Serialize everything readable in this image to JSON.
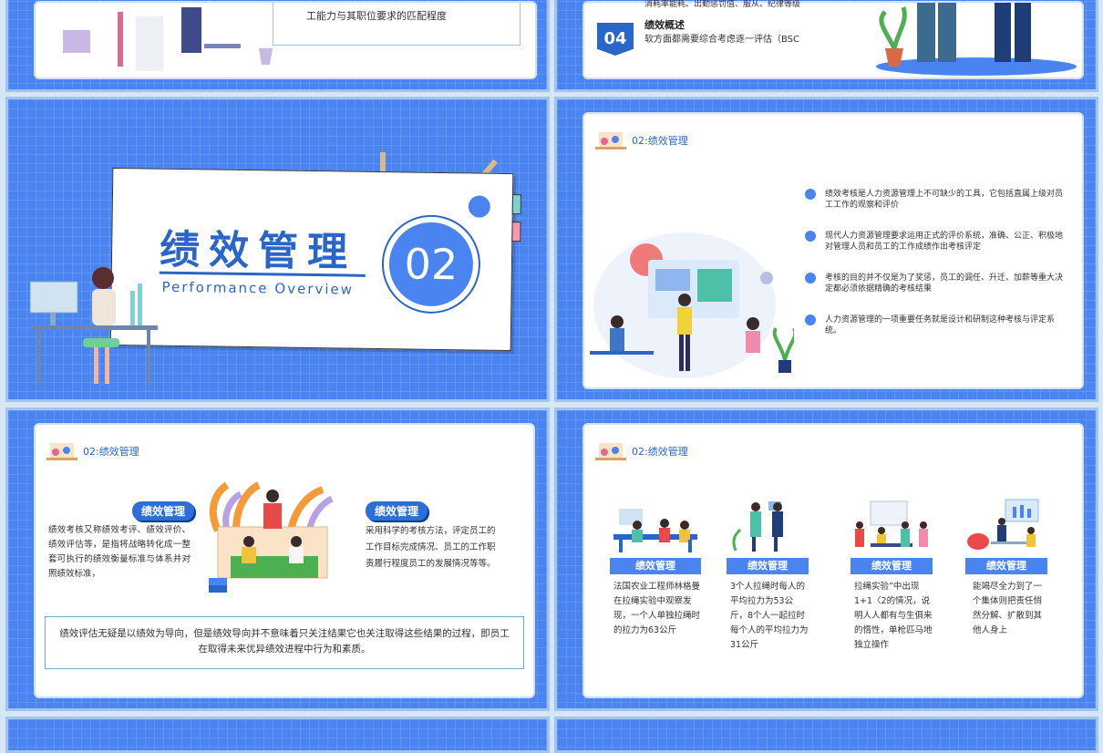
{
  "slide_top_left": {
    "caption": "工能力与其职位要求的匹配程度"
  },
  "slide_top_right": {
    "prev_text": "消耗率能耗、出勤惩罚值、服从、纪律等级",
    "item_number": "04",
    "item_title": "绩效概述",
    "item_text": "软方面都需要综合考虑逐一评估（BSC"
  },
  "title_slide": {
    "title": "绩效管理",
    "subtitle": "Performance Overview",
    "number": "02"
  },
  "list_slide": {
    "header": "02:绩效管理",
    "items": [
      "绩效考核是人力资源管理上不可缺少的工具，它包括直属上级对员工工作的观察和评价",
      "现代人力资源管理要求运用正式的评价系统，准确、公正、积极地对管理人员和员工的工作成绩作出考核评定",
      "考核的目的并不仅是为了奖惩，员工的调任、升迁、加薪等重大决定都必须依据精确的考核结果",
      "人力资源管理的一项重要任务就是设计和研制这种考核与评定系统。"
    ]
  },
  "two_col_slide": {
    "header": "02:绩效管理",
    "left_label": "绩效管理",
    "left_text": "绩效考核又称绩效考评、绩效评价、绩效评估等，是指将战略转化成一整套可执行的绩效衡量标准与体系并对照绩效标准，",
    "right_label": "绩效管理",
    "right_text": "采用科学的考核方法，评定员工的工作目标完成情况、员工的工作职责履行程度员工的发展情况等等。",
    "bottom_text": "绩效评估无疑是以绩效为导向，但是绩效导向并不意味着只关注结果它也关注取得这些结果的过程，即员工在取得未来优异绩效进程中行为和素质。"
  },
  "four_col_slide": {
    "header": "02:绩效管理",
    "columns": [
      {
        "label": "绩效管理",
        "text": "法国农业工程师林格曼在拉绳实验中观察发现，一个人单独拉绳时的拉力为63公斤"
      },
      {
        "label": "绩效管理",
        "text": "3个人拉绳时每人的平均拉力为53公斤，8个人一起拉时每个人的平均拉力为31公斤"
      },
      {
        "label": "绩效管理",
        "text": "拉绳实验”中出现1+1〈2的情况，说明人人都有与生俱来的惰性，单枪匹马地独立操作"
      },
      {
        "label": "绩效管理",
        "text": "能竭尽全力到了一个集体则把责任悄然分解、扩散到其他人身上"
      }
    ]
  },
  "colors": {
    "primary": "#4a84f0",
    "accent": "#2a66c8",
    "border": "#9fc3f5"
  }
}
